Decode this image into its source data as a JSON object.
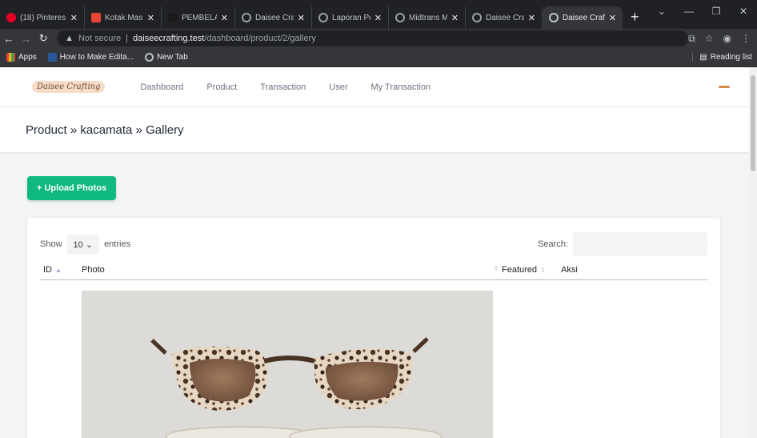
{
  "browser": {
    "tabs": [
      {
        "title": "(18) Pinteres",
        "favicon_color": "#e60023"
      },
      {
        "title": "Kotak Masu",
        "favicon_color": "#ea4335"
      },
      {
        "title": "PEMBELAJA",
        "favicon_color": "#1a1a1a"
      },
      {
        "title": "Daisee Craf",
        "favicon_color": "#9aa0a6"
      },
      {
        "title": "Laporan Pe",
        "favicon_color": "#9aa0a6"
      },
      {
        "title": "Midtrans M",
        "favicon_color": "#9aa0a6"
      },
      {
        "title": "Daisee Craf",
        "favicon_color": "#9aa0a6"
      },
      {
        "title": "Daisee Craf",
        "favicon_color": "#9aa0a6",
        "active": true
      }
    ],
    "url_security": "Not secure",
    "url_host": "daiseecrafting.test",
    "url_path": "/dashboard/product/2/gallery",
    "bookmarks": [
      {
        "label": "Apps",
        "icon": "apps-grid-icon"
      },
      {
        "label": "How to Make Edita...",
        "icon": "word-icon"
      },
      {
        "label": "New Tab",
        "icon": "globe-icon"
      }
    ],
    "reading_list": "Reading list"
  },
  "app": {
    "logo_text": "Daisee Crafting",
    "nav": [
      "Dashboard",
      "Product",
      "Transaction",
      "User",
      "My Transaction"
    ],
    "breadcrumb": "Product » kacamata » Gallery",
    "upload_label": "+ Upload Photos",
    "table": {
      "show_label": "Show",
      "length_value": "10",
      "entries_label": "entries",
      "search_label": "Search:",
      "search_value": "",
      "columns": [
        "ID",
        "Photo",
        "Featured",
        "Aksi"
      ]
    }
  },
  "colors": {
    "accent_green": "#10b981",
    "chrome_dark": "#202124"
  }
}
